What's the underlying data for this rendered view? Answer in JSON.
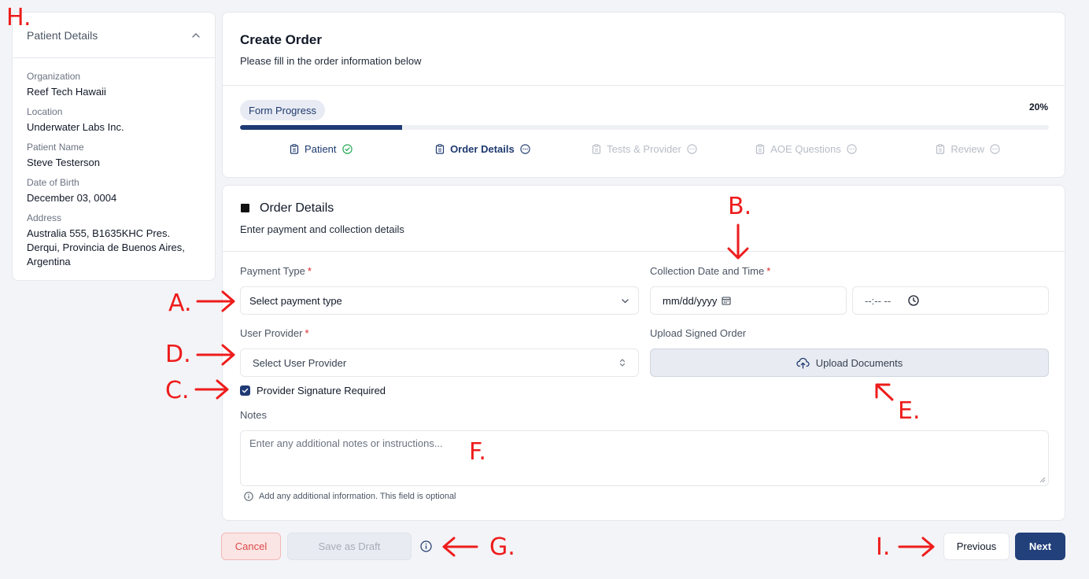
{
  "sidebar": {
    "title": "Patient Details",
    "fields": [
      {
        "label": "Organization",
        "value": "Reef Tech Hawaii"
      },
      {
        "label": "Location",
        "value": "Underwater Labs Inc."
      },
      {
        "label": "Patient Name",
        "value": "Steve Testerson"
      },
      {
        "label": "Date of Birth",
        "value": "December 03, 0004"
      },
      {
        "label": "Address",
        "value": "Australia 555, B1635KHC Pres. Derqui, Provincia de Buenos Aires, Argentina"
      }
    ]
  },
  "header": {
    "title": "Create Order",
    "subtitle": "Please fill in the order information below"
  },
  "progress": {
    "label": "Form Progress",
    "percent_text": "20%",
    "fraction": 0.2,
    "steps": [
      {
        "label": "Patient",
        "status": "done"
      },
      {
        "label": "Order Details",
        "status": "active"
      },
      {
        "label": "Tests & Provider",
        "status": "todo"
      },
      {
        "label": "AOE Questions",
        "status": "todo"
      },
      {
        "label": "Review",
        "status": "todo"
      }
    ]
  },
  "order_details": {
    "title": "Order Details",
    "subtitle": "Enter payment and collection details",
    "payment_type": {
      "label": "Payment Type",
      "required": "*",
      "placeholder": "Select payment type"
    },
    "collection": {
      "label": "Collection Date and Time",
      "required": "*",
      "date_placeholder": "mm/dd/yyyy",
      "time_placeholder": "--:-- --"
    },
    "user_provider": {
      "label": "User Provider",
      "required": "*",
      "placeholder": "Select User Provider"
    },
    "upload": {
      "label": "Upload Signed Order",
      "button": "Upload Documents"
    },
    "signature": {
      "label": "Provider Signature Required",
      "checked": true
    },
    "notes": {
      "label": "Notes",
      "placeholder": "Enter any additional notes or instructions...",
      "hint": "Add any additional information. This field is optional"
    }
  },
  "footer": {
    "cancel": "Cancel",
    "save_draft": "Save as Draft",
    "previous": "Previous",
    "next": "Next"
  },
  "annotations": {
    "A": "A.",
    "B": "B.",
    "C": "C.",
    "D": "D.",
    "E": "E.",
    "F": "F.",
    "G": "G.",
    "H": "H.",
    "I": "I."
  },
  "colors": {
    "accent": "#1f3a74",
    "required": "#dc2626",
    "annotation": "#ee1c1c",
    "step_done_check": "#16a34a"
  }
}
